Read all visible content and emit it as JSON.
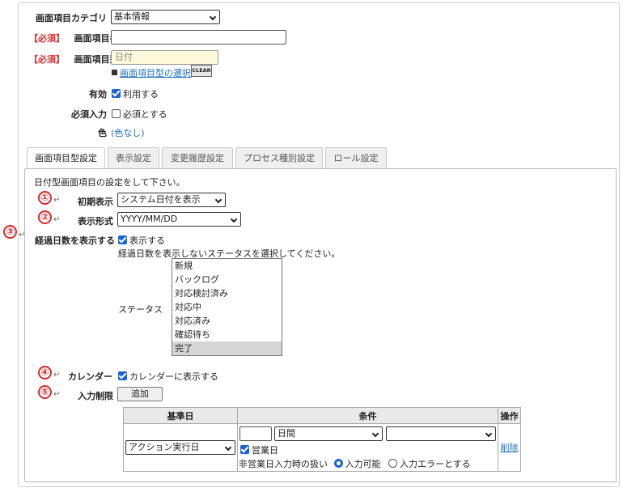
{
  "form": {
    "category": {
      "label": "画面項目カテゴリ",
      "value": "基本情報"
    },
    "item_name": {
      "required": "【必須】",
      "label": "画面項目名",
      "value": ""
    },
    "item_type": {
      "required": "【必須】",
      "label": "画面項目型",
      "value": "日付",
      "select_link": "画面項目型の選択",
      "clear_label": "CLEAR"
    },
    "enabled": {
      "label": "有効",
      "checkbox_label": "利用する",
      "checked": true
    },
    "required_input": {
      "label": "必須入力",
      "checkbox_label": "必須とする",
      "checked": false
    },
    "color": {
      "label": "色",
      "value": "(色なし)"
    }
  },
  "tabs": [
    {
      "label": "画面項目型設定",
      "active": true
    },
    {
      "label": "表示設定",
      "active": false
    },
    {
      "label": "変更履歴設定",
      "active": false
    },
    {
      "label": "プロセス種別設定",
      "active": false
    },
    {
      "label": "ロール設定",
      "active": false
    }
  ],
  "panel": {
    "intro": "日付型画面項目の設定をして下さい。",
    "markers": [
      "①",
      "②",
      "③",
      "④",
      "⑤"
    ],
    "initial_display": {
      "label": "初期表示",
      "value": "システム日付を表示"
    },
    "display_format": {
      "label": "表示形式",
      "value": "YYYY/MM/DD"
    },
    "elapsed_days": {
      "label": "経過日数を表示する",
      "checkbox_label": "表示する",
      "checked": true,
      "hint": "経過日数を表示しないステータスを選択してください。",
      "status_label": "ステータス",
      "statuses": [
        "新規",
        "バックログ",
        "対応検討済み",
        "対応中",
        "対応済み",
        "確認待ち",
        "完了"
      ],
      "selected_index": 6
    },
    "calendar": {
      "label": "カレンダー",
      "checkbox_label": "カレンダーに表示する",
      "checked": true
    },
    "input_limit": {
      "label": "入力制限",
      "add_label": "追加",
      "table": {
        "headers": [
          "基準日",
          "条件",
          "操作"
        ],
        "row": {
          "base_date": "アクション実行日",
          "number": "",
          "unit": "日間",
          "direction": "",
          "business_day_label": "営業日",
          "business_day_checked": true,
          "non_business_label": "非営業日入力時の扱い",
          "option_allow": "入力可能",
          "option_error": "入力エラーとする",
          "selected_option": "allow",
          "delete_label": "削除"
        }
      }
    }
  },
  "colors": {
    "required": "#d43030",
    "link": "#1a6fc9",
    "marker": "#d62b2b",
    "checkbox": "#1a63d2"
  }
}
